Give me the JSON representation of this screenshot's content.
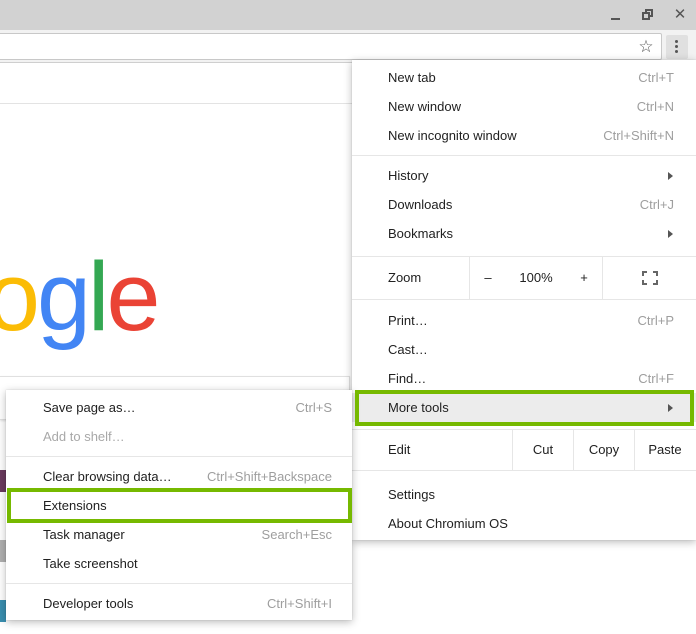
{
  "window": {
    "minimize_icon": "minimize-icon",
    "restore_icon": "restore-icon",
    "close_icon": "close-icon",
    "close_glyph": "✕"
  },
  "toolbar": {
    "star_glyph": "☆",
    "menu_icon": "three-dot-menu-icon"
  },
  "page": {
    "logo_letters": [
      "o",
      "g",
      "l",
      "e"
    ],
    "colors": {
      "yellow": "#fbbc05",
      "blue": "#4285f4",
      "green": "#34a853",
      "red": "#ea4335"
    }
  },
  "main_menu": {
    "new_tab": {
      "label": "New tab",
      "shortcut": "Ctrl+T"
    },
    "new_window": {
      "label": "New window",
      "shortcut": "Ctrl+N"
    },
    "new_incognito": {
      "label": "New incognito window",
      "shortcut": "Ctrl+Shift+N"
    },
    "history": {
      "label": "History"
    },
    "downloads": {
      "label": "Downloads",
      "shortcut": "Ctrl+J"
    },
    "bookmarks": {
      "label": "Bookmarks"
    },
    "zoom": {
      "label": "Zoom",
      "minus": "–",
      "value": "100%",
      "plus": "+"
    },
    "print": {
      "label": "Print…",
      "shortcut": "Ctrl+P"
    },
    "cast": {
      "label": "Cast…"
    },
    "find": {
      "label": "Find…",
      "shortcut": "Ctrl+F"
    },
    "more_tools": {
      "label": "More tools"
    },
    "edit": {
      "label": "Edit",
      "cut": "Cut",
      "copy": "Copy",
      "paste": "Paste"
    },
    "settings": {
      "label": "Settings"
    },
    "about": {
      "label": "About Chromium OS"
    }
  },
  "sub_menu": {
    "save_page": {
      "label": "Save page as…",
      "shortcut": "Ctrl+S"
    },
    "add_to_shelf": {
      "label": "Add to shelf…"
    },
    "clear_data": {
      "label": "Clear browsing data…",
      "shortcut": "Ctrl+Shift+Backspace"
    },
    "extensions": {
      "label": "Extensions"
    },
    "task_manager": {
      "label": "Task manager",
      "shortcut": "Search+Esc"
    },
    "screenshot": {
      "label": "Take screenshot"
    },
    "dev_tools": {
      "label": "Developer tools",
      "shortcut": "Ctrl+Shift+I"
    }
  },
  "highlight_color": "#76b900"
}
